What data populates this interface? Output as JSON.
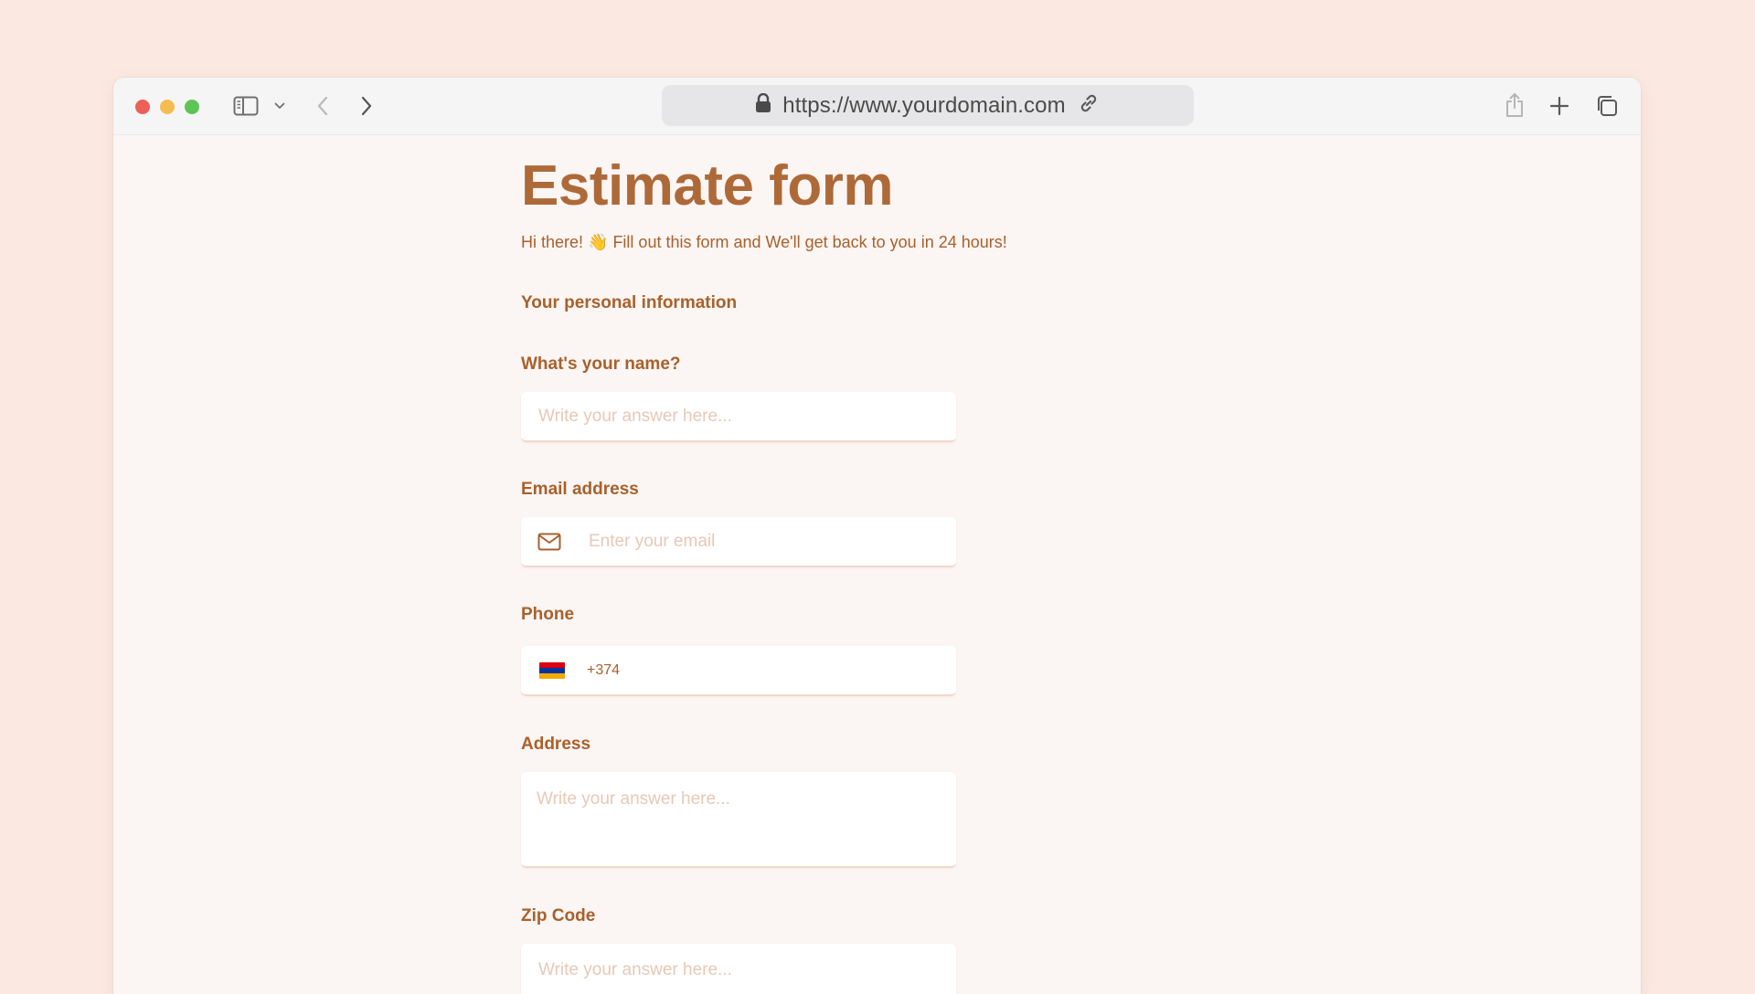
{
  "browser": {
    "url": "https://www.yourdomain.com"
  },
  "form": {
    "title": "Estimate form",
    "subtitle": "Hi there! 👋 Fill out this form and We'll get back to you in 24 hours!",
    "section_heading": "Your personal information",
    "fields": {
      "name": {
        "label": "What's your name?",
        "placeholder": "Write your answer here..."
      },
      "email": {
        "label": "Email address",
        "placeholder": "Enter your email",
        "icon": "mail-icon"
      },
      "phone": {
        "label": "Phone",
        "country_code": "+374",
        "flag": "armenia-flag-icon",
        "flag_colors": [
          "#d90012",
          "#0033a0",
          "#f2a800"
        ]
      },
      "address": {
        "label": "Address",
        "placeholder": "Write your answer here..."
      },
      "zip": {
        "label": "Zip Code",
        "placeholder": "Write your answer here..."
      }
    }
  },
  "colors": {
    "page_background": "#fbe9e1",
    "window_background": "#fbf5f3",
    "accent_text": "#a8612c",
    "placeholder_text": "#e8c8b6"
  }
}
